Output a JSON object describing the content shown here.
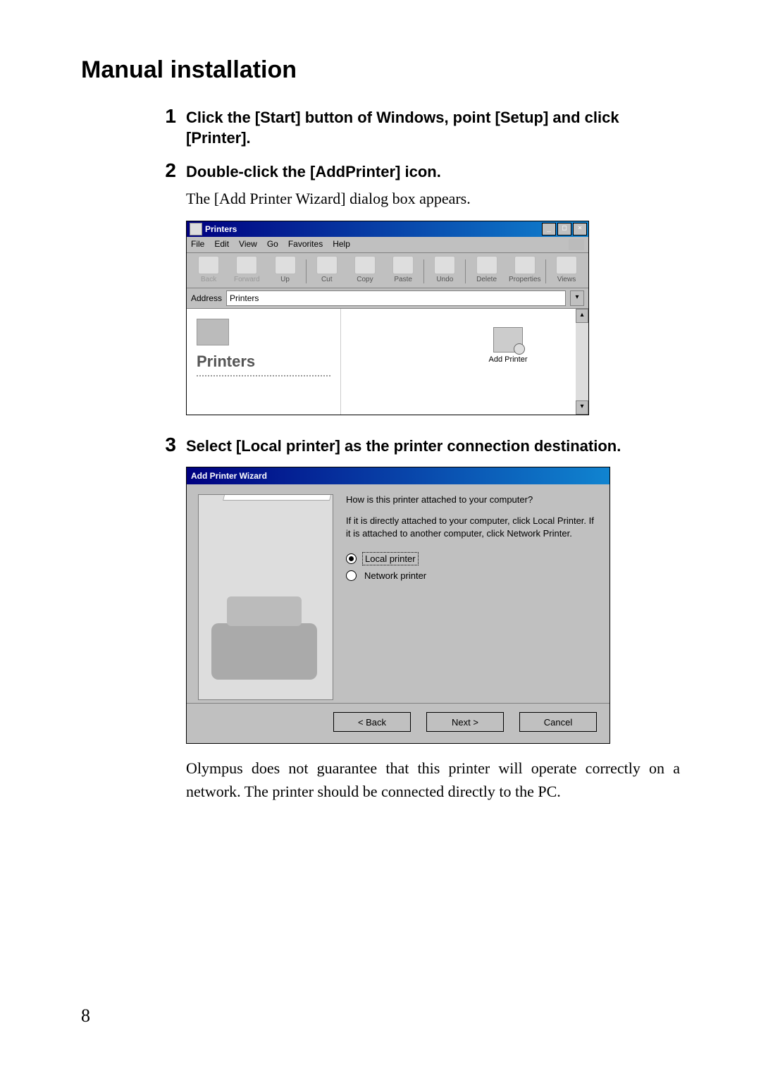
{
  "page_number": "8",
  "title": "Manual installation",
  "steps": [
    {
      "num": "1",
      "title": "Click the [Start] button of Windows, point [Setup] and click [Printer]."
    },
    {
      "num": "2",
      "title": "Double-click the [AddPrinter] icon.",
      "desc": "The [Add Printer Wizard] dialog box appears."
    },
    {
      "num": "3",
      "title": "Select [Local printer] as the printer connection destination.",
      "note": "Olympus does not guarantee that this printer will operate correctly on a network. The printer should be connected directly to the PC."
    }
  ],
  "printers_window": {
    "title": "Printers",
    "menus": [
      "File",
      "Edit",
      "View",
      "Go",
      "Favorites",
      "Help"
    ],
    "toolbar": [
      {
        "label": "Back"
      },
      {
        "label": "Forward"
      },
      {
        "label": "Up"
      },
      {
        "label": "Cut"
      },
      {
        "label": "Copy"
      },
      {
        "label": "Paste"
      },
      {
        "label": "Undo"
      },
      {
        "label": "Delete"
      },
      {
        "label": "Properties"
      },
      {
        "label": "Views"
      }
    ],
    "address_label": "Address",
    "address_value": "Printers",
    "sidebar_title": "Printers",
    "add_printer_icon_label": "Add Printer"
  },
  "wizard": {
    "title": "Add Printer Wizard",
    "question": "How is this printer attached to your computer?",
    "explanation": "If it is directly attached to your computer, click Local Printer. If it is attached to another computer, click Network Printer.",
    "option_local": "Local printer",
    "option_network": "Network printer",
    "btn_back": "< Back",
    "btn_next": "Next >",
    "btn_cancel": "Cancel"
  }
}
